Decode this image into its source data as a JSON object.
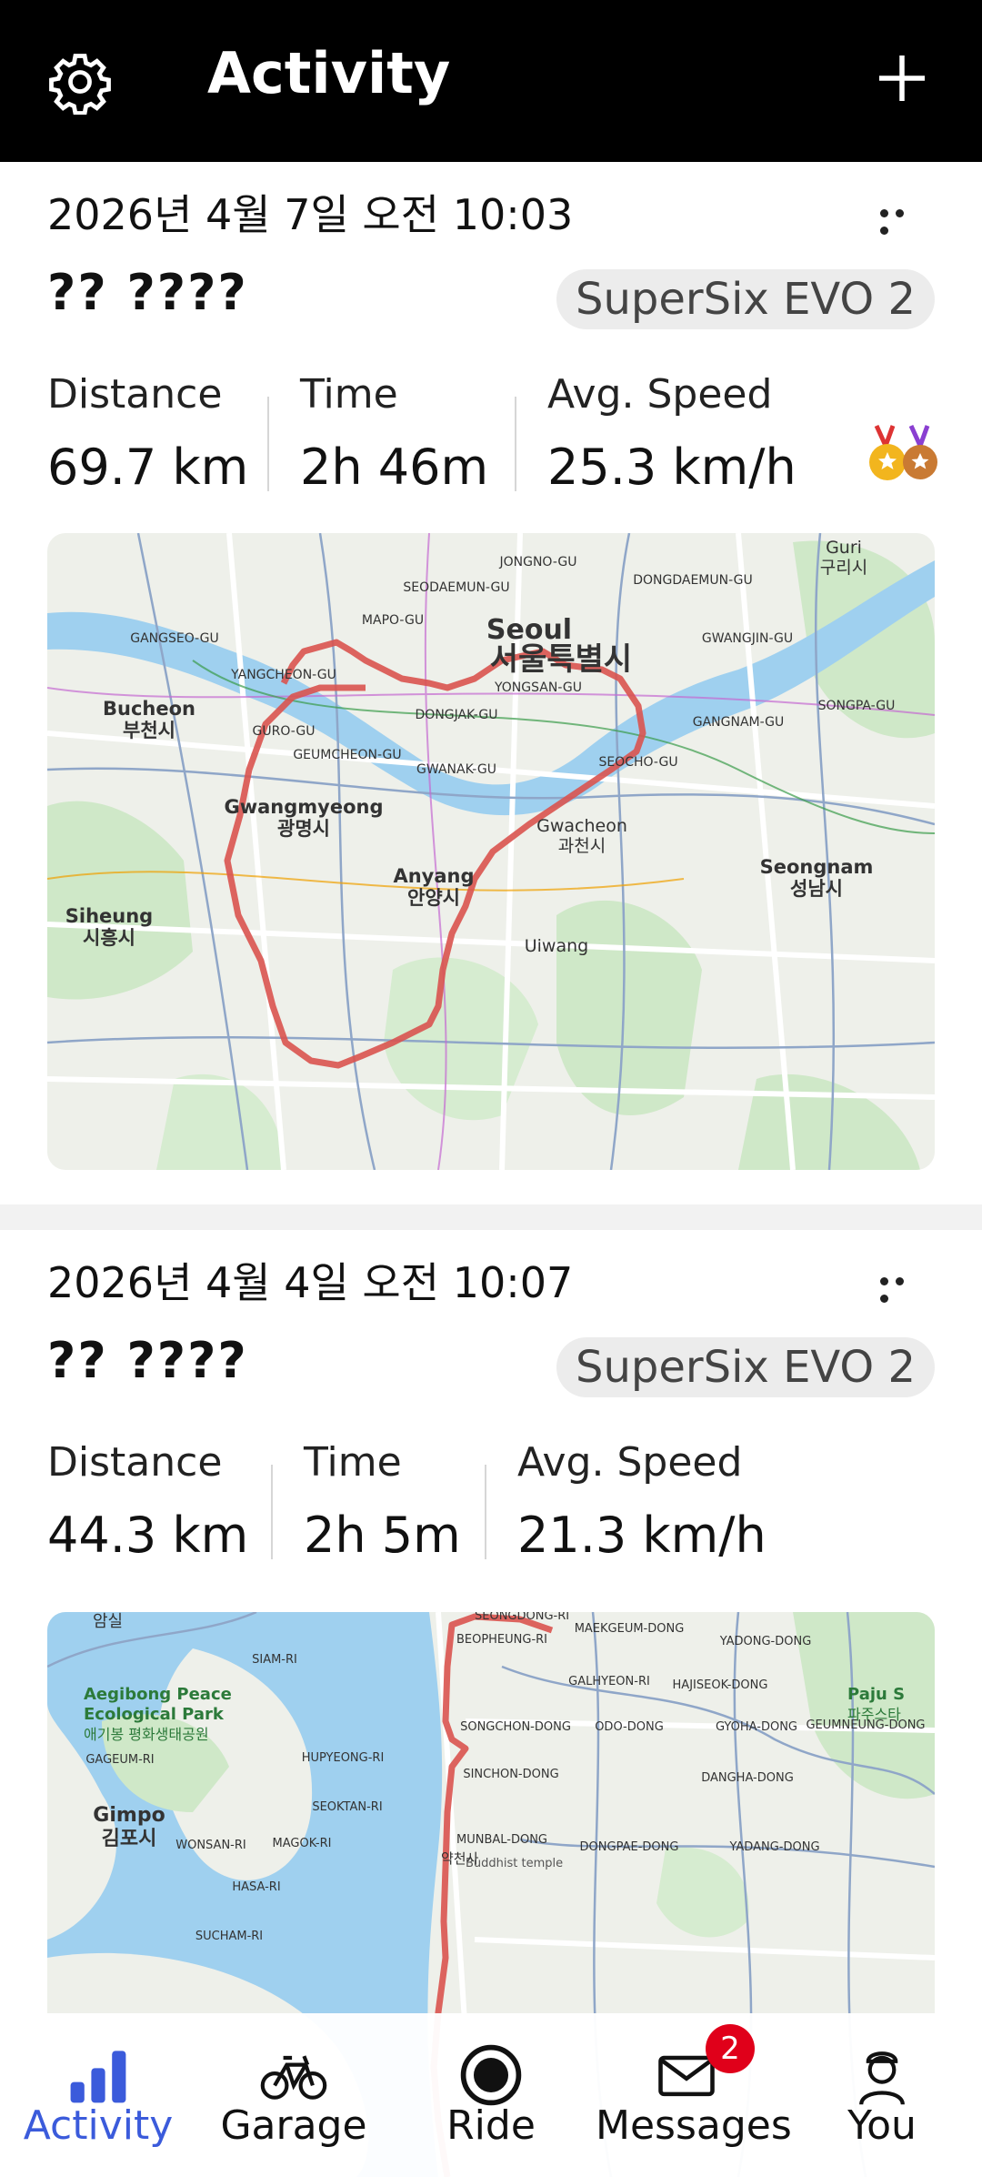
{
  "header": {
    "title": "Activity"
  },
  "activities": [
    {
      "date": "2026년 4월 7일 오전 10:03",
      "name": "?? ????",
      "bike": "SuperSix EVO 2",
      "stats": [
        {
          "label": "Distance",
          "value": "69.7 km"
        },
        {
          "label": "Time",
          "value": "2h 46m"
        },
        {
          "label": "Avg. Speed",
          "value": "25.3 km/h"
        }
      ],
      "map_labels": {
        "seoul": "Seoul",
        "seoul_ko": "서울특별시",
        "bucheon": "Bucheon",
        "bucheon_ko": "부천시",
        "gwangmyeong": "Gwangmyeong",
        "gwangmyeong_ko": "광명시",
        "anyang": "Anyang",
        "anyang_ko": "안양시",
        "gwacheon": "Gwacheon",
        "gwacheon_ko": "과천시",
        "seongnam": "Seongnam",
        "seongnam_ko": "성남시",
        "siheung": "Siheung",
        "siheung_ko": "시흥시",
        "guri": "Guri",
        "guri_ko": "구리시",
        "uiwang": "Uiwang",
        "gangnam": "GANGNAM-GU",
        "yongsan": "YONGSAN-GU",
        "mapo": "MAPO-GU",
        "songpa": "SONGPA-GU",
        "seocho": "SEOCHO-GU",
        "guro": "GURO-GU",
        "dongjak": "DONGJAK-GU",
        "gwanak": "GWANAK-GU",
        "geumcheon": "GEUMCHEON-GU",
        "yangcheon": "YANGCHEON-GU",
        "gwangjin": "GWANGJIN-GU",
        "dongdaemun": "DONGDAEMUN-GU",
        "seodaemun": "SEODAEMUN-GU",
        "jongno": "JONGNO-GU",
        "gangseo": "GANGSEO-GU"
      }
    },
    {
      "date": "2026년 4월 4일 오전 10:07",
      "name": "?? ????",
      "bike": "SuperSix EVO 2",
      "stats": [
        {
          "label": "Distance",
          "value": "44.3 km"
        },
        {
          "label": "Time",
          "value": "2h 5m"
        },
        {
          "label": "Avg. Speed",
          "value": "21.3 km/h"
        }
      ],
      "map_labels": {
        "aegibong": "Aegibong Peace",
        "aegibong2": "Ecological Park",
        "aegibong_ko": "애기봉 평화생태공원",
        "gimpo": "Gimpo",
        "gimpo_ko": "김포시",
        "paju": "Paju S",
        "paju_ko": "파주스타",
        "siam": "SIAM-RI",
        "gageum": "GAGEUM-RI",
        "hupyeong": "HUPYEONG-RI",
        "songchon": "SONGCHON-DONG",
        "sinchon": "SINCHON-DONG",
        "munbal": "MUNBAL-DONG",
        "beopheung": "BEOPHEUNG-RI",
        "galhyeon": "GALHYEON-RI",
        "hajiseok": "HAJISEOK-DONG",
        "maekgeum": "MAEKGEUM-DONG",
        "yadong": "YADONG-DONG",
        "geumneung": "GEUMNEUNG-DONG",
        "gyoha": "GYOHA-DONG",
        "odo": "ODO-DONG",
        "dangha": "DANGHA-DONG",
        "dongpae": "DONGPAE-DONG",
        "yadang": "YADANG-DONG",
        "seoktan": "SEOKTAN-RI",
        "magok": "MAGOK-RI",
        "wonsan": "WONSAN-RI",
        "buddhist": "Buddhist temple",
        "yakcheonsa": "약천사",
        "amsil": "암실",
        "seongdong": "SEONGDONG-RI",
        "hasa": "HASA-RI",
        "sucham": "SUCHAM-RI"
      }
    }
  ],
  "nav": [
    {
      "label": "Activity",
      "icon": "bar-chart-icon",
      "active": true
    },
    {
      "label": "Garage",
      "icon": "bicycle-icon"
    },
    {
      "label": "Ride",
      "icon": "record-icon"
    },
    {
      "label": "Messages",
      "icon": "envelope-icon",
      "badge": "2"
    },
    {
      "label": "You",
      "icon": "person-icon"
    }
  ],
  "colors": {
    "accent": "#3b5bdb",
    "route": "#d9534f",
    "badge": "#e0001a",
    "header_bg": "#000000"
  }
}
